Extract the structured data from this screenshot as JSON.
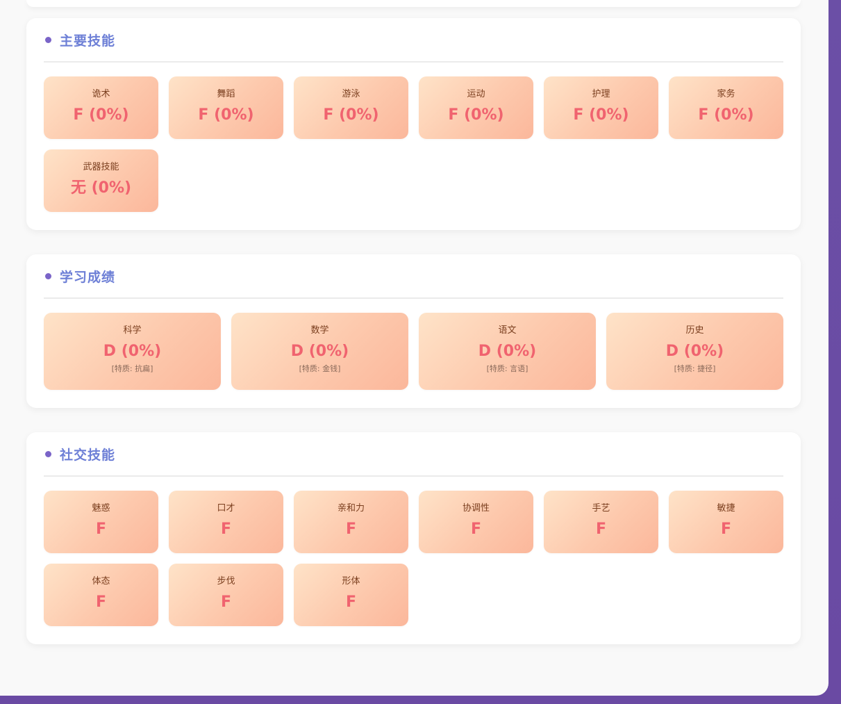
{
  "sections": {
    "main_skills": {
      "title": "主要技能",
      "items": [
        {
          "label": "诡术",
          "value": "F (0%)"
        },
        {
          "label": "舞蹈",
          "value": "F (0%)"
        },
        {
          "label": "游泳",
          "value": "F (0%)"
        },
        {
          "label": "运动",
          "value": "F (0%)"
        },
        {
          "label": "护理",
          "value": "F (0%)"
        },
        {
          "label": "家务",
          "value": "F (0%)"
        },
        {
          "label": "武器技能",
          "value": "无 (0%)"
        }
      ]
    },
    "academics": {
      "title": "学习成绩",
      "items": [
        {
          "label": "科学",
          "value": "D (0%)",
          "trait": "[特质: 抗扁]"
        },
        {
          "label": "数学",
          "value": "D (0%)",
          "trait": "[特质: 金钱]"
        },
        {
          "label": "语文",
          "value": "D (0%)",
          "trait": "[特质: 言语]"
        },
        {
          "label": "历史",
          "value": "D (0%)",
          "trait": "[特质: 捷径]"
        }
      ]
    },
    "social_skills": {
      "title": "社交技能",
      "items": [
        {
          "label": "魅惑",
          "value": "F"
        },
        {
          "label": "口才",
          "value": "F"
        },
        {
          "label": "亲和力",
          "value": "F"
        },
        {
          "label": "协调性",
          "value": "F"
        },
        {
          "label": "手艺",
          "value": "F"
        },
        {
          "label": "敏捷",
          "value": "F"
        },
        {
          "label": "体态",
          "value": "F"
        },
        {
          "label": "步伐",
          "value": "F"
        },
        {
          "label": "形体",
          "value": "F"
        }
      ]
    }
  },
  "colors": {
    "accent_title": "#6d7fd6",
    "bullet": "#7a64c8",
    "value_text": "#f0636f",
    "background": "#6b4fa6"
  }
}
